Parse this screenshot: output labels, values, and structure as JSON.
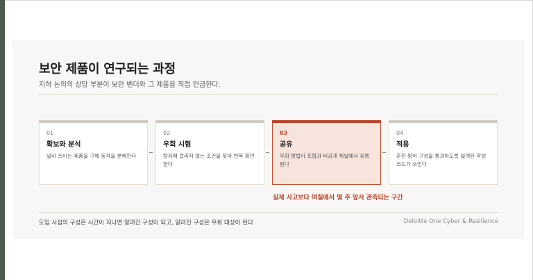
{
  "header": {
    "title": "보안 제품이 연구되는 과정",
    "subtitle": "지하 논의의 상당 부분이 보안 벤더와 그 제품을 직접 언급한다."
  },
  "steps": [
    {
      "number": "01",
      "title": "확보와 분석",
      "description": "널리 쓰이는 제품을 구해 동작을 분해한다"
    },
    {
      "number": "02",
      "title": "우회 시험",
      "description": "탐지에 걸리지 않는 조건을 찾아 반복 확인한다"
    },
    {
      "number": "03",
      "title": "공유",
      "description": "우회 방법이 포럼과 비공개 채널에서 유통된다"
    },
    {
      "number": "04",
      "title": "적용",
      "description": "흔한 방어 구성을 통과하도록 설계된 악성코드가 쓰인다"
    }
  ],
  "callout": "실제 사고보다 며칠에서 몇 주 앞서 관측되는 구간",
  "footer": {
    "note": "도입 시점의 구성은 시간이 지나면 알려진 구성이 되고, 알려진 구성은 우회 대상이 된다",
    "brand": "Deloitte One Cyber & Resilience"
  },
  "colors": {
    "accent": "#b8442a",
    "highlight_fill": "#f6e4dd",
    "panel_bg": "#f8f7f5",
    "left_bar": "#4f5a4f"
  }
}
